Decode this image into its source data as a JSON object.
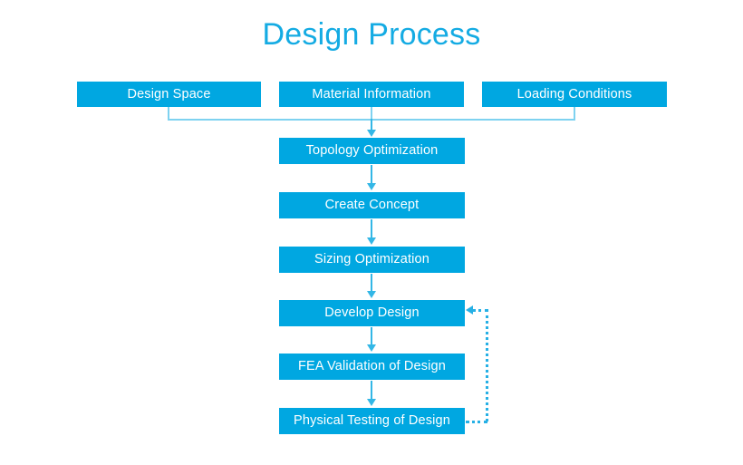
{
  "title": "Design Process",
  "accent_color": "#00A7E1",
  "title_color": "#14ABE3",
  "connector_color": "#33B7E6",
  "bracket_color": "#7ED2F0",
  "dotted_color": "#26B0E5",
  "background_color": "#FFFFFF",
  "diagram": {
    "inputs": [
      {
        "id": "design-space",
        "label": "Design Space"
      },
      {
        "id": "material-information",
        "label": "Material Information"
      },
      {
        "id": "loading-conditions",
        "label": "Loading Conditions"
      }
    ],
    "steps": [
      {
        "id": "topology-optimization",
        "label": "Topology Optimization"
      },
      {
        "id": "create-concept",
        "label": "Create Concept"
      },
      {
        "id": "sizing-optimization",
        "label": "Sizing Optimization"
      },
      {
        "id": "develop-design",
        "label": "Develop Design"
      },
      {
        "id": "fea-validation-of-design",
        "label": "FEA Validation of Design"
      },
      {
        "id": "physical-testing-of-design",
        "label": "Physical Testing of Design"
      }
    ],
    "connectors": {
      "merge_bracket": "three inputs merge into Topology Optimization",
      "feedback_loop": "Physical Testing of Design feeds back to Develop Design",
      "feedback_style": "dotted"
    }
  }
}
